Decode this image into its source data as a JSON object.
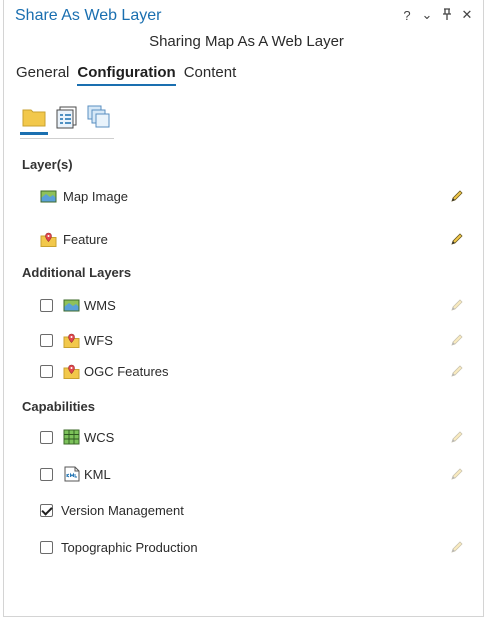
{
  "pane": {
    "title": "Share As Web Layer",
    "controls": {
      "help": "?",
      "menu": "⌄",
      "pin": "⊥",
      "close": "✕"
    }
  },
  "subtitle": "Sharing Map As A Web Layer",
  "tabs": [
    {
      "label": "General",
      "active": false
    },
    {
      "label": "Configuration",
      "active": true
    },
    {
      "label": "Content",
      "active": false
    }
  ],
  "icon_tabs": [
    {
      "icon": "layers-config-icon",
      "active": true
    },
    {
      "icon": "properties-config-icon",
      "active": false
    },
    {
      "icon": "pages-config-icon",
      "active": false
    }
  ],
  "sections": {
    "layers": {
      "heading": "Layer(s)",
      "items": [
        {
          "label": "Map Image",
          "icon": "map-image-icon"
        },
        {
          "label": "Feature",
          "icon": "feature-icon"
        }
      ]
    },
    "additional": {
      "heading": "Additional Layers",
      "items": [
        {
          "label": "WMS",
          "icon": "map-image-icon",
          "checked": false
        },
        {
          "label": "WFS",
          "icon": "feature-icon",
          "checked": false
        },
        {
          "label": "OGC Features",
          "icon": "feature-icon",
          "checked": false
        }
      ]
    },
    "capabilities": {
      "heading": "Capabilities",
      "items": [
        {
          "label": "WCS",
          "icon": "grid-icon",
          "checked": false
        },
        {
          "label": "KML",
          "icon": "kml-icon",
          "checked": false
        },
        {
          "label": "Version Management",
          "checked": true
        },
        {
          "label": "Topographic Production",
          "checked": false
        }
      ]
    }
  },
  "colors": {
    "accent": "#1a6fb0",
    "folder": "#f2c84b"
  }
}
